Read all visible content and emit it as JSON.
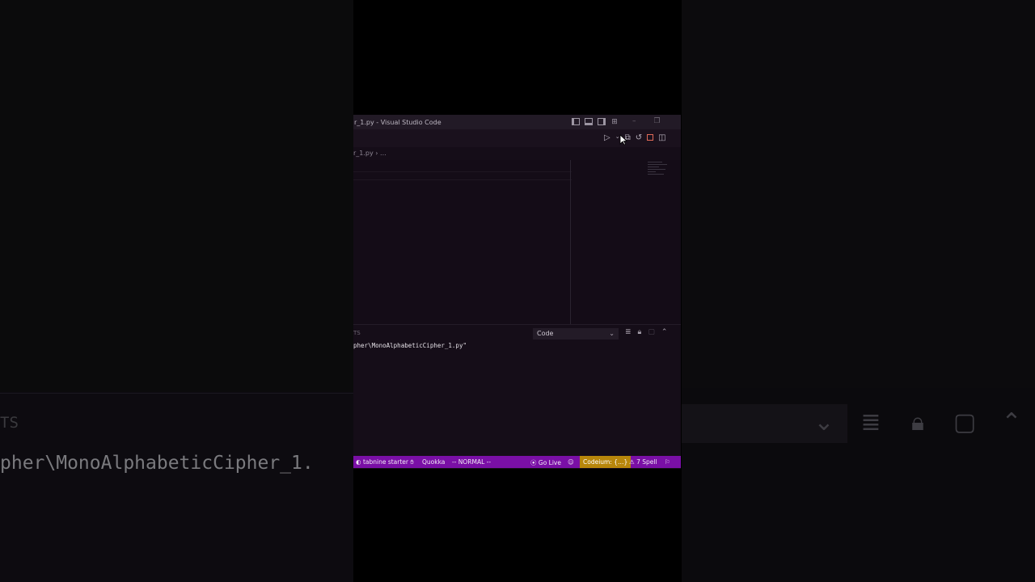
{
  "background": {
    "left_panel_label": "TS",
    "left_path_text": "pher\\MonoAlphabeticCipher_1."
  },
  "window": {
    "title": "r_1.py - Visual Studio Code"
  },
  "breadcrumb": {
    "file": "r_1.py",
    "separator": "›",
    "rest": "..."
  },
  "panel": {
    "tab_fragment": "TS",
    "dropdown_value": "Code",
    "output_line": "pher\\MonoAlphabeticCipher_1.py\""
  },
  "statusbar": {
    "tabnine": "tabnine starter",
    "quokka": "Quokka",
    "mode": "-- NORMAL --",
    "go_live": "Go Live",
    "codeium": "Codeium: {…}",
    "spell": "⚠ 7 Spell"
  },
  "colors": {
    "statusbar_bg": "#7a0fa6",
    "codeium_bg": "#b8860b",
    "stop_red": "#e06a58"
  }
}
